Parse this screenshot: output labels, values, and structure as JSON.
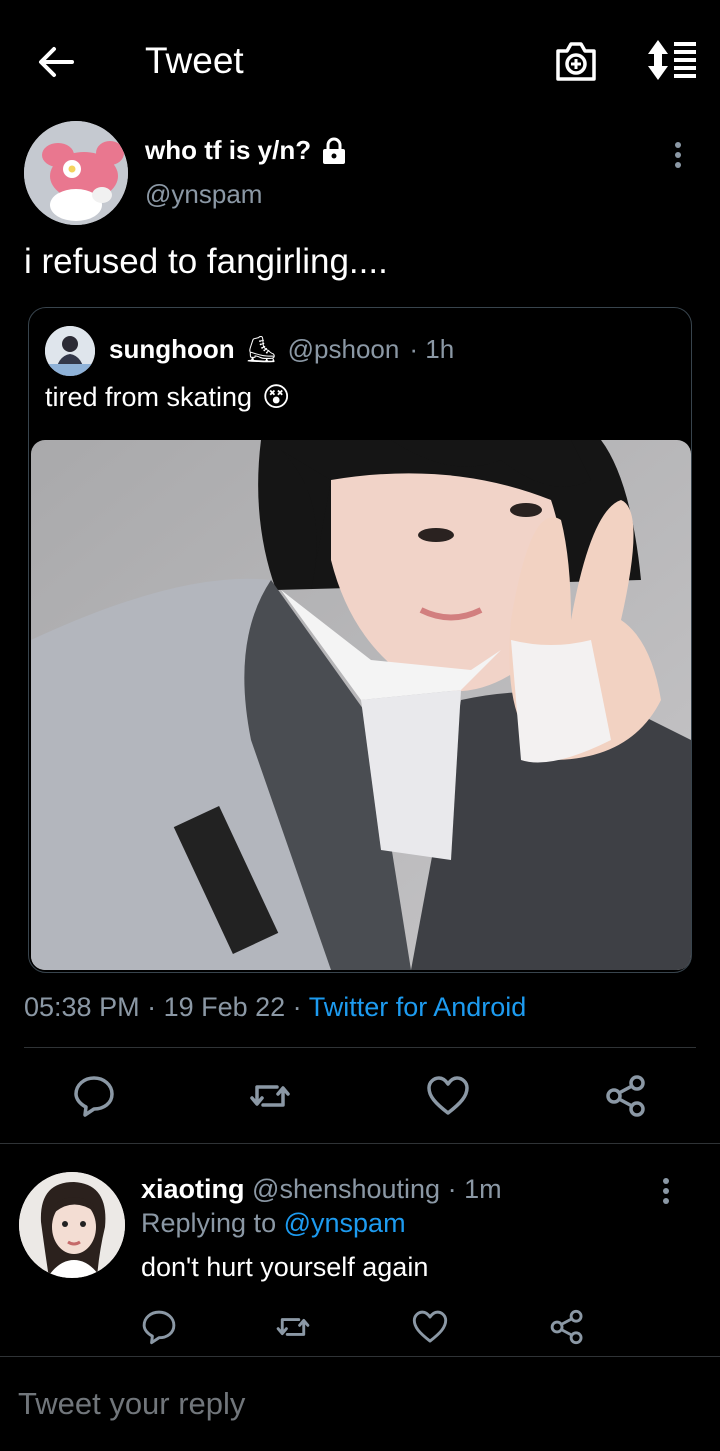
{
  "header": {
    "title": "Tweet",
    "back_icon": "arrow-left-icon",
    "camera_icon": "camera-plus-icon",
    "sort_icon": "sort-list-icon"
  },
  "tweet": {
    "display_name": "who tf is y/n?",
    "handle": "@ynspam",
    "text": "i refused to fangirling....",
    "lock_icon": "lock-icon",
    "quoted": {
      "display_name": "sunghoon",
      "name_emoji": "⛸",
      "handle": "@pshoon",
      "time": "· 1h",
      "text": "tired from skating",
      "text_emoji": "😵"
    },
    "time": "05:38 PM",
    "date": "· 19 Feb 22 ·",
    "source": "Twitter for Android",
    "actions": [
      "reply-icon",
      "retweet-icon",
      "like-icon",
      "share-icon"
    ]
  },
  "reply": {
    "display_name": "xiaoting",
    "handle": "@shenshouting",
    "time": "· 1m",
    "replying_prefix": "Replying to",
    "replying_to": "@ynspam",
    "text": "don't hurt yourself again"
  },
  "composer": {
    "placeholder": "Tweet your reply"
  },
  "colors": {
    "background": "#000000",
    "link": "#1d9bf0",
    "muted": "#8b98a5",
    "divider": "#2f3336"
  }
}
